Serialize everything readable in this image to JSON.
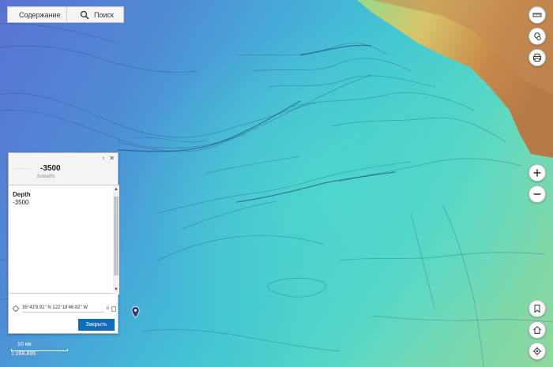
{
  "toolbar": {
    "contents_label": "Содержание",
    "search_label": "Поиск"
  },
  "popup": {
    "title": "-3500",
    "subtitle": "Isobaths",
    "attribute_name": "Depth",
    "attribute_value": "-3500",
    "coordinates": "35°43'9.91\" N 122°18'46.82\" W",
    "coord_extra": "o",
    "close_label": "Закрыть"
  },
  "scale": {
    "distance": "10 км",
    "ratio": "1:288,895"
  },
  "colors": {
    "deep_ocean": "#5a72d2",
    "shallow_ocean": "#55d6c5",
    "land_low": "#8fd79a",
    "land_high": "#c88a4a",
    "button_primary": "#0f6cbd"
  },
  "icons": {
    "contents": "layers-icon",
    "search": "search-icon",
    "measure": "ruler-icon",
    "basemap": "basemap-icon",
    "print": "printer-icon",
    "zoom_in": "plus-icon",
    "zoom_out": "minus-icon",
    "bookmarks": "bookmark-icon",
    "home": "home-icon",
    "locate": "locate-icon"
  }
}
